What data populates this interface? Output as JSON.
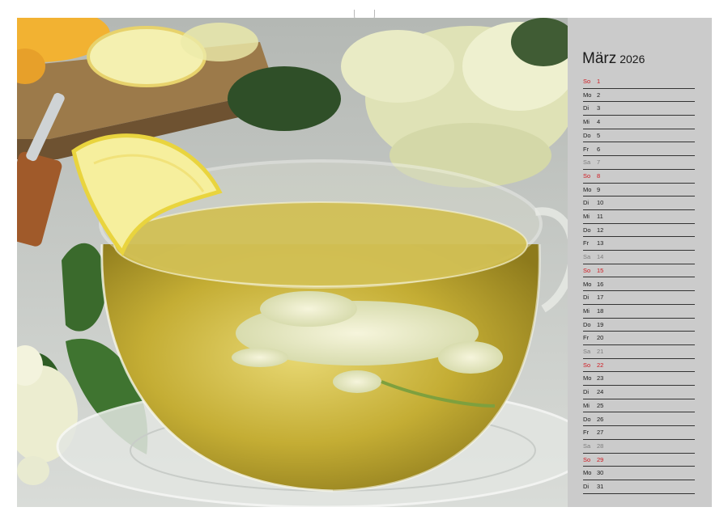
{
  "calendar": {
    "month": "März",
    "year": "2026",
    "days": [
      {
        "wd": "So",
        "day": "1",
        "type": "sun"
      },
      {
        "wd": "Mo",
        "day": "2",
        "type": "weekday"
      },
      {
        "wd": "Di",
        "day": "3",
        "type": "weekday"
      },
      {
        "wd": "Mi",
        "day": "4",
        "type": "weekday"
      },
      {
        "wd": "Do",
        "day": "5",
        "type": "weekday"
      },
      {
        "wd": "Fr",
        "day": "6",
        "type": "weekday"
      },
      {
        "wd": "Sa",
        "day": "7",
        "type": "sat"
      },
      {
        "wd": "So",
        "day": "8",
        "type": "sun"
      },
      {
        "wd": "Mo",
        "day": "9",
        "type": "weekday"
      },
      {
        "wd": "Di",
        "day": "10",
        "type": "weekday"
      },
      {
        "wd": "Mi",
        "day": "11",
        "type": "weekday"
      },
      {
        "wd": "Do",
        "day": "12",
        "type": "weekday"
      },
      {
        "wd": "Fr",
        "day": "13",
        "type": "weekday"
      },
      {
        "wd": "Sa",
        "day": "14",
        "type": "sat"
      },
      {
        "wd": "So",
        "day": "15",
        "type": "sun"
      },
      {
        "wd": "Mo",
        "day": "16",
        "type": "weekday"
      },
      {
        "wd": "Di",
        "day": "17",
        "type": "weekday"
      },
      {
        "wd": "Mi",
        "day": "18",
        "type": "weekday"
      },
      {
        "wd": "Do",
        "day": "19",
        "type": "weekday"
      },
      {
        "wd": "Fr",
        "day": "20",
        "type": "weekday"
      },
      {
        "wd": "Sa",
        "day": "21",
        "type": "sat"
      },
      {
        "wd": "So",
        "day": "22",
        "type": "sun"
      },
      {
        "wd": "Mo",
        "day": "23",
        "type": "weekday"
      },
      {
        "wd": "Di",
        "day": "24",
        "type": "weekday"
      },
      {
        "wd": "Mi",
        "day": "25",
        "type": "weekday"
      },
      {
        "wd": "Do",
        "day": "26",
        "type": "weekday"
      },
      {
        "wd": "Fr",
        "day": "27",
        "type": "weekday"
      },
      {
        "wd": "Sa",
        "day": "28",
        "type": "sat"
      },
      {
        "wd": "So",
        "day": "29",
        "type": "sun"
      },
      {
        "wd": "Mo",
        "day": "30",
        "type": "weekday"
      },
      {
        "wd": "Di",
        "day": "31",
        "type": "weekday"
      }
    ]
  },
  "colors": {
    "sunday": "#d0181f",
    "saturday": "#7d7d7d",
    "weekday": "#1a1a1a",
    "panel": "#cbcbcb",
    "tea": "#c9b53a"
  }
}
